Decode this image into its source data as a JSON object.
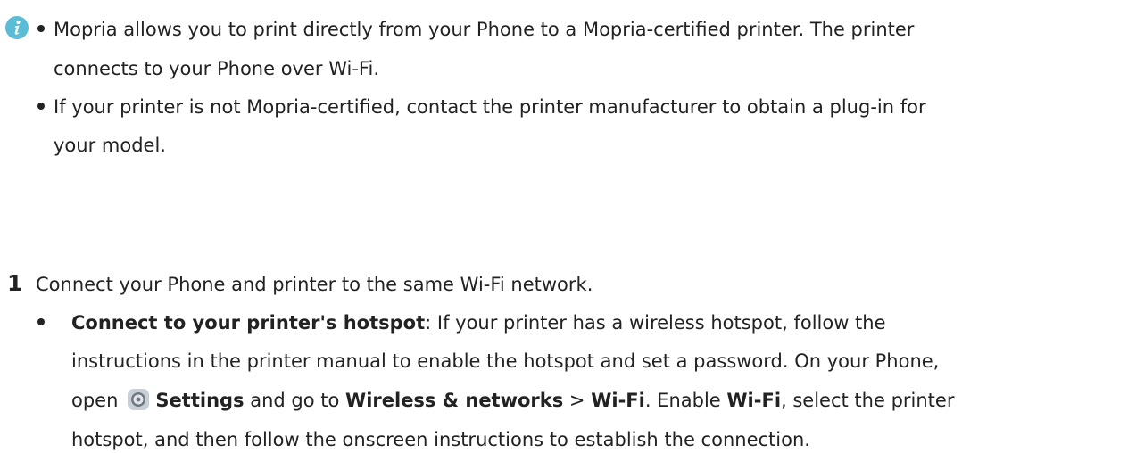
{
  "note": {
    "icon": "info-icon",
    "items": [
      {
        "line1": "Mopria allows you to print directly from your Phone to a Mopria-certified printer. The printer",
        "line2": "connects to your Phone over Wi-Fi."
      },
      {
        "line1": "If your printer is not Mopria-certified, contact the printer manufacturer to obtain a plug-in for",
        "line2": "your model."
      }
    ]
  },
  "step": {
    "number": "1",
    "text": "Connect your Phone and printer to the same Wi-Fi network.",
    "substep": {
      "title": "Connect to your printer's hotspot",
      "line1_rest": ": If your printer has a wireless hotspot, follow the",
      "line2": "instructions in the printer manual to enable the hotspot and set a password. On your Phone,",
      "line3_open": "open",
      "settings_icon": "settings-gear-icon",
      "settings": "Settings",
      "and_go_to": " and go to ",
      "wireless_networks": "Wireless & networks",
      "arrow": " > ",
      "wifi": "Wi-Fi",
      "enable": ". Enable ",
      "wifi2": "Wi-Fi",
      "select_rest": ", select the printer",
      "line4": "hotspot, and then follow the onscreen instructions to establish the connection."
    }
  },
  "colors": {
    "info_icon": "#5bbcd6",
    "text": "#222222"
  }
}
